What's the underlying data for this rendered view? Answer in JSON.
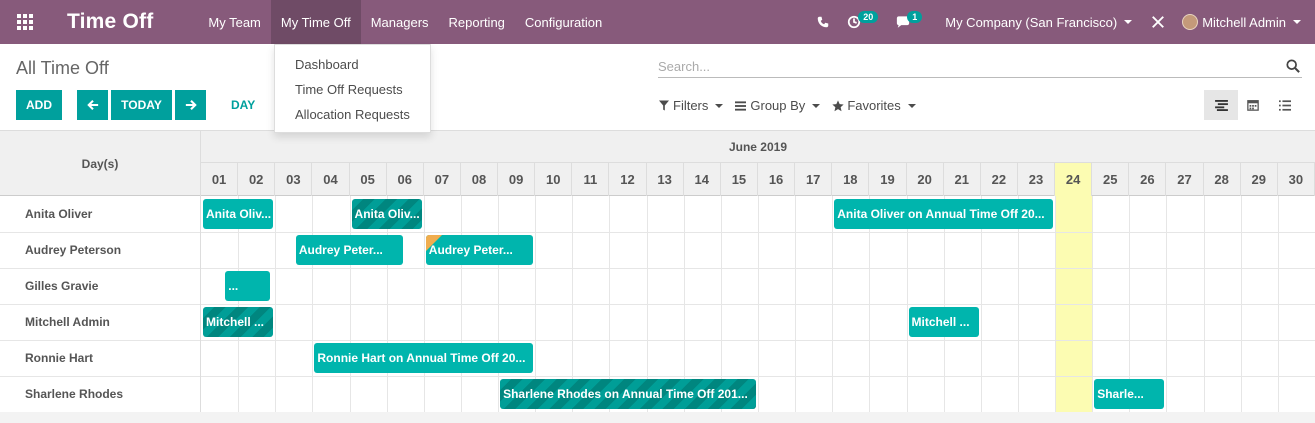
{
  "app": {
    "title": "Time Off",
    "menu": [
      "My Team",
      "My Time Off",
      "Managers",
      "Reporting",
      "Configuration"
    ],
    "active_menu": "My Time Off"
  },
  "systray": {
    "activity_count": "20",
    "message_count": "1",
    "company": "My Company (San Francisco)",
    "user": "Mitchell Admin"
  },
  "dropdown": {
    "items": [
      "Dashboard",
      "Time Off Requests",
      "Allocation Requests"
    ]
  },
  "control": {
    "breadcrumb": "All Time Off",
    "add_label": "ADD",
    "today_label": "TODAY",
    "scale_label": "DAY",
    "search_placeholder": "Search...",
    "filters_label": "Filters",
    "groupby_label": "Group By",
    "favorites_label": "Favorites"
  },
  "gantt": {
    "row_header": "Day(s)",
    "month": "June 2019",
    "days": [
      "01",
      "02",
      "03",
      "04",
      "05",
      "06",
      "07",
      "08",
      "09",
      "10",
      "11",
      "12",
      "13",
      "14",
      "15",
      "16",
      "17",
      "18",
      "19",
      "20",
      "21",
      "22",
      "23",
      "24",
      "25",
      "26",
      "27",
      "28",
      "29",
      "30"
    ],
    "today": "24",
    "rows": [
      {
        "name": "Anita Oliver"
      },
      {
        "name": "Audrey Peterson"
      },
      {
        "name": "Gilles Gravie"
      },
      {
        "name": "Mitchell Admin"
      },
      {
        "name": "Ronnie Hart"
      },
      {
        "name": "Sharlene Rhodes"
      }
    ],
    "pills": [
      {
        "row": 0,
        "start": 1,
        "end": 2,
        "label": "Anita Oliv...",
        "style": "approved"
      },
      {
        "row": 0,
        "start": 5,
        "end": 6,
        "label": "Anita Oliv...",
        "style": "striped"
      },
      {
        "row": 0,
        "start": 18,
        "end": 23,
        "label": "Anita Oliver on Annual Time Off 20...",
        "style": "approved"
      },
      {
        "row": 1,
        "start": 3.5,
        "end": 5.5,
        "label": "Audrey Peter...",
        "style": "approved"
      },
      {
        "row": 1,
        "start": 7,
        "end": 9,
        "label": "Audrey Peter...",
        "style": "approved",
        "corner": true
      },
      {
        "row": 2,
        "start": 1.6,
        "end": 1.9,
        "label": "...",
        "style": "approved"
      },
      {
        "row": 3,
        "start": 1,
        "end": 2,
        "label": "Mitchell ...",
        "style": "striped"
      },
      {
        "row": 3,
        "start": 20,
        "end": 21,
        "label": "Mitchell ...",
        "style": "approved"
      },
      {
        "row": 4,
        "start": 4,
        "end": 9,
        "label": "Ronnie Hart on Annual Time Off 20...",
        "style": "approved"
      },
      {
        "row": 5,
        "start": 9,
        "end": 15,
        "label": "Sharlene Rhodes on Annual Time Off 201...",
        "style": "striped"
      },
      {
        "row": 5,
        "start": 25,
        "end": 26,
        "label": "Sharle...",
        "style": "approved"
      }
    ]
  }
}
